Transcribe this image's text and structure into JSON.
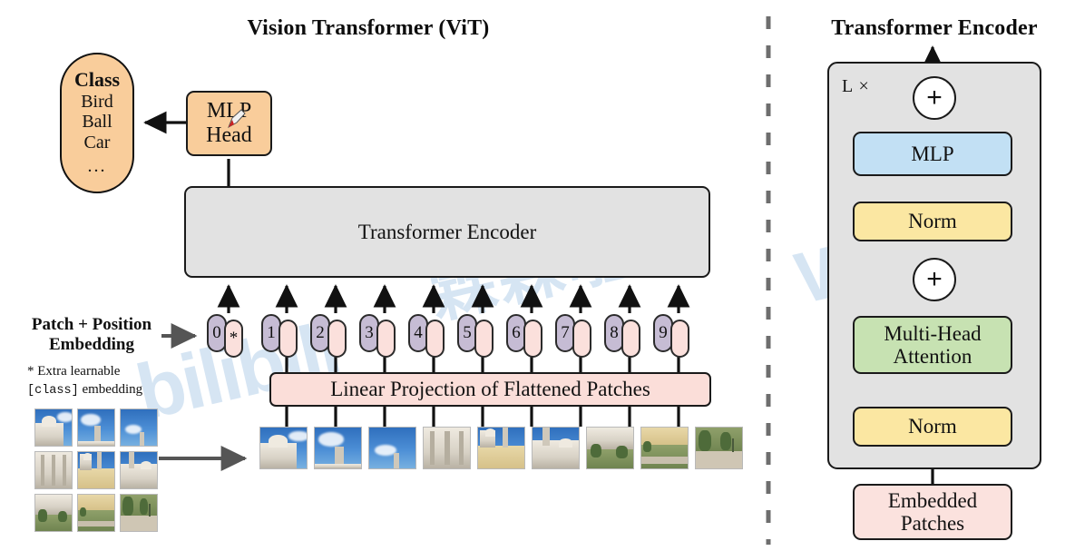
{
  "titles": {
    "left": "Vision Transformer (ViT)",
    "right": "Transformer Encoder"
  },
  "left_panel": {
    "class_box": {
      "heading": "Class",
      "items": [
        "Bird",
        "Ball",
        "Car"
      ],
      "ellipsis": "..."
    },
    "mlp_head": {
      "line1": "MLP",
      "line2": "Head"
    },
    "encoder_box": {
      "label": "Transformer Encoder"
    },
    "linear_projection": {
      "label": "Linear Projection of Flattened Patches"
    },
    "embedding_label": {
      "line1": "Patch + Position",
      "line2": "Embedding"
    },
    "footnote": {
      "line1_prefix": "* Extra learnable",
      "line2_mono": "[class]",
      "line2_suffix": " embedding"
    },
    "tokens": [
      {
        "pos": "0",
        "pat": "*"
      },
      {
        "pos": "1",
        "pat": ""
      },
      {
        "pos": "2",
        "pat": ""
      },
      {
        "pos": "3",
        "pat": ""
      },
      {
        "pos": "4",
        "pat": ""
      },
      {
        "pos": "5",
        "pat": ""
      },
      {
        "pos": "6",
        "pat": ""
      },
      {
        "pos": "7",
        "pat": ""
      },
      {
        "pos": "8",
        "pat": ""
      },
      {
        "pos": "9",
        "pat": ""
      }
    ],
    "source_image_grid_rows": 3,
    "source_image_grid_cols": 3,
    "flattened_patch_count": 9
  },
  "right_panel": {
    "repeat_label": "L ×",
    "blocks": {
      "mlp": "MLP",
      "norm_top": "Norm",
      "attention_line1": "Multi-Head",
      "attention_line2": "Attention",
      "norm_bottom": "Norm",
      "embedded_line1": "Embedded",
      "embedded_line2": "Patches"
    },
    "add_symbol": "+"
  },
  "watermark": {
    "text_latin": "bilibili",
    "text_cn": "霖霖啦",
    "text_suffix": "Wz"
  },
  "colors": {
    "class_box": "#f9cd9b",
    "mlp_head": "#f9cd9b",
    "encoder_gray": "#e2e2e2",
    "linear_projection_pink": "#fbded9",
    "position_embedding_purple": "#c6bcd4",
    "patch_embedding_pink": "#fbe0dc",
    "mlp_blue": "#c2e0f4",
    "norm_yellow": "#fbe7a2",
    "attention_green": "#c7e2b2",
    "embedded_patches_pink": "#fbe2de",
    "stroke": "#1a1a1a",
    "watermark_blue": "#cfe1f2"
  }
}
